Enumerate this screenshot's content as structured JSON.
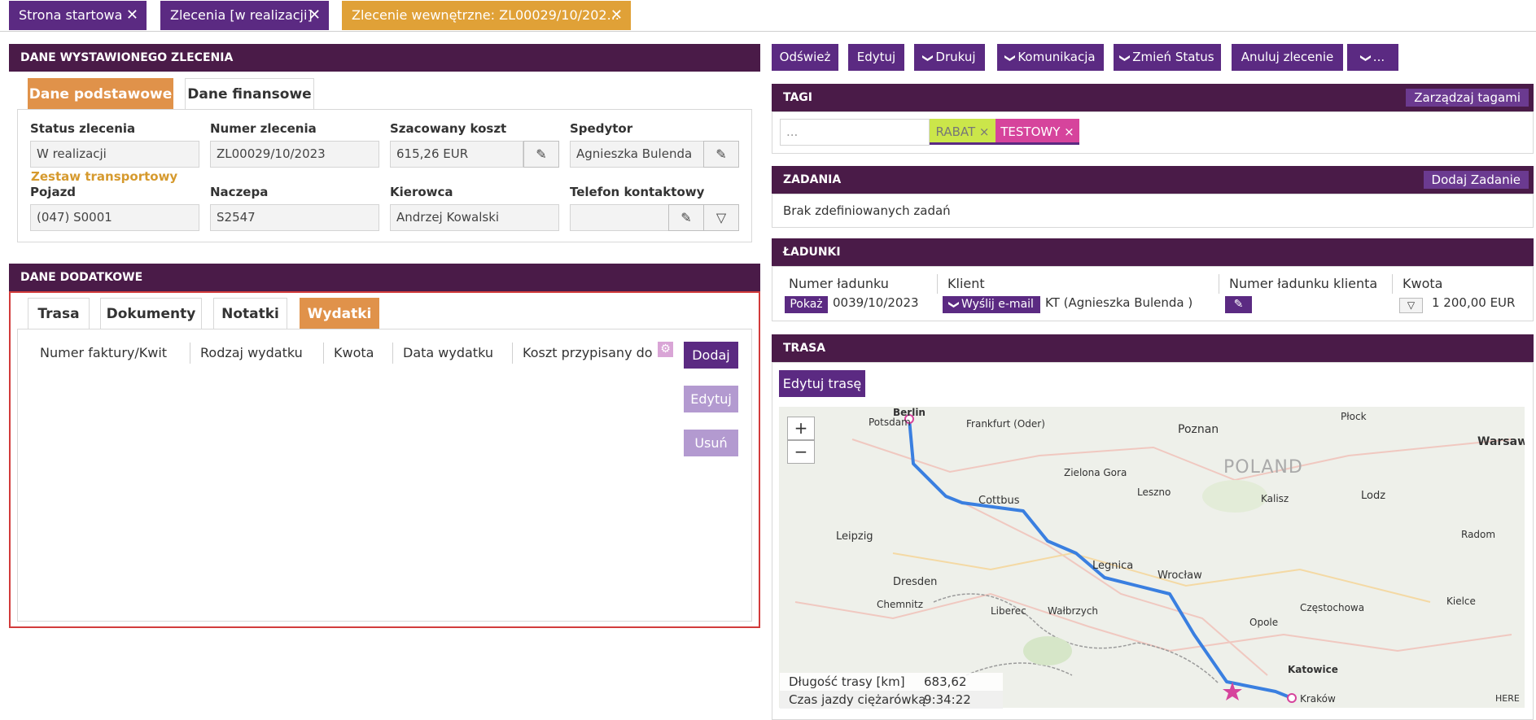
{
  "window_tabs": [
    {
      "label": "Strona startowa"
    },
    {
      "label": "Zlecenia [w realizacji]"
    },
    {
      "label": "Zlecenie wewnętrzne: ZL00029/10/202..."
    }
  ],
  "close_glyph": "✕",
  "order_panel": {
    "title": "DANE WYSTAWIONEGO ZLECENIA",
    "tabs": [
      "Dane podstawowe",
      "Dane finansowe"
    ],
    "fields": {
      "status_label": "Status zlecenia",
      "status_value": "W realizacji",
      "number_label": "Numer zlecenia",
      "number_value": "ZL00029/10/2023",
      "cost_label": "Szacowany koszt",
      "cost_value": "615,26 EUR",
      "forwarder_label": "Spedytor",
      "forwarder_value": "Agnieszka Bulenda",
      "set_label": "Zestaw transportowy",
      "vehicle_label": "Pojazd",
      "vehicle_value": "(047) S0001",
      "trailer_label": "Naczepa",
      "trailer_value": "S2547",
      "driver_label": "Kierowca",
      "driver_value": "Andrzej Kowalski",
      "phone_label": "Telefon kontaktowy",
      "phone_value": ""
    }
  },
  "extra_panel": {
    "title": "DANE DODATKOWE",
    "tabs": [
      "Trasa",
      "Dokumenty",
      "Notatki",
      "Wydatki"
    ],
    "columns": [
      "Numer faktury/Kwit",
      "Rodzaj wydatku",
      "Kwota",
      "Data wydatku",
      "Koszt przypisany do"
    ],
    "buttons": {
      "add": "Dodaj",
      "edit": "Edytuj",
      "delete": "Usuń"
    }
  },
  "actions": {
    "refresh": "Odśwież",
    "edit": "Edytuj",
    "print": "Drukuj",
    "communication": "Komunikacja",
    "change_status": "Zmień Status",
    "cancel": "Anuluj zlecenie",
    "more": "..."
  },
  "tags_panel": {
    "title": "TAGI",
    "manage": "Zarządzaj tagami",
    "input_placeholder": "...",
    "tags": [
      {
        "label": "RABAT ×",
        "color": "#cbe64a"
      },
      {
        "label": "TESTOWY ×",
        "color": "#d6449c"
      }
    ]
  },
  "tasks_panel": {
    "title": "ZADANIA",
    "add": "Dodaj Zadanie",
    "empty": "Brak zdefiniowanych zadań"
  },
  "loads_panel": {
    "title": "ŁADUNKI",
    "columns": [
      "Numer ładunku",
      "Klient",
      "Numer ładunku klienta",
      "Kwota"
    ],
    "row": {
      "show": "Pokaż",
      "number": "0039/10/2023",
      "email": "Wyślij e-mail",
      "client": "KT (Agnieszka Bulenda )",
      "amount": "1 200,00 EUR"
    }
  },
  "route_panel": {
    "title": "TRASA",
    "edit": "Edytuj trasę",
    "zoom_in": "+",
    "zoom_out": "−",
    "country": "POLAND",
    "attribution": "HERE",
    "cities": [
      "Berlin",
      "Potsdam",
      "Frankfurt (Oder)",
      "Poznan",
      "Płock",
      "Warsaw",
      "Cottbus",
      "Zielona Gora",
      "Leszno",
      "Kalisz",
      "Lodz",
      "Radom",
      "Leipzig",
      "Dresden",
      "Legnica",
      "Wrocław",
      "Opole",
      "Częstochowa",
      "Kielce",
      "Chemnitz",
      "Liberec",
      "Wałbrzych",
      "Katowice",
      "Kraków"
    ],
    "length_label": "Długość trasy [km]",
    "length_value": "683,62",
    "time_label": "Czas jazdy ciężarówką",
    "time_value": "9:34:22"
  },
  "colors": {
    "purple": "#5b2a82",
    "header": "#4a1b48",
    "orange": "#e0924a",
    "route": "#3a7fe0"
  }
}
